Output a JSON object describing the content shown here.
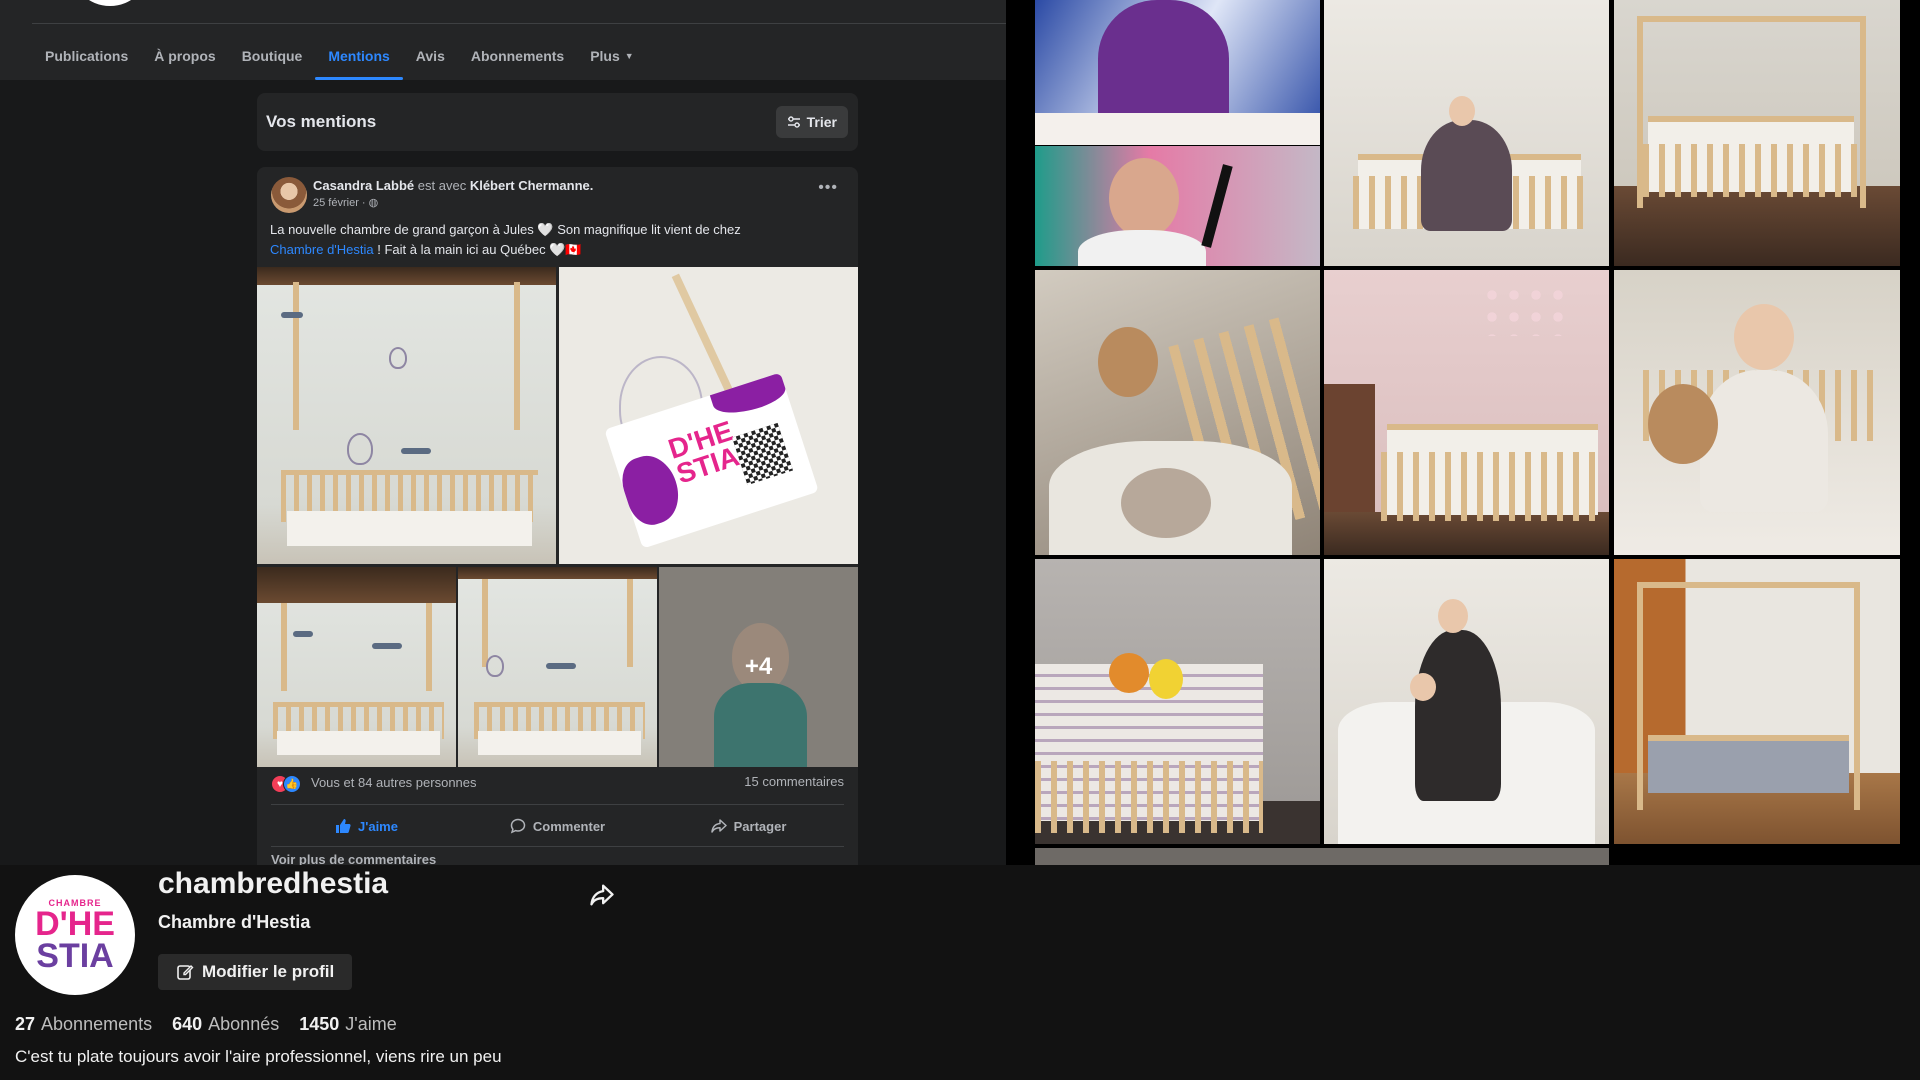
{
  "facebook": {
    "tabs": [
      {
        "label": "Publications"
      },
      {
        "label": "À propos"
      },
      {
        "label": "Boutique"
      },
      {
        "label": "Mentions"
      },
      {
        "label": "Avis"
      },
      {
        "label": "Abonnements"
      },
      {
        "label": "Plus"
      }
    ],
    "active_tab": "Mentions",
    "mentions_title": "Vos mentions",
    "sort_label": "Trier",
    "post": {
      "author": "Casandra Labbé",
      "with_text": "est avec",
      "tagged": "Klébert Chermanne.",
      "date": "25 février · ",
      "text_line1": "La nouvelle chambre de grand garçon à Jules 🤍 Son magnifique lit vient de chez",
      "link_text": "Chambre d'Hestia",
      "text_line2_rest": " ! Fait à la main ici au Québec 🤍🇨🇦",
      "photo_overflow": "+4",
      "reactions_text": "Vous et 84 autres personnes",
      "comments_count": "15 commentaires",
      "like_label": "J'aime",
      "comment_label": "Commenter",
      "share_label": "Partager",
      "more_comments": "Voir plus de commentaires"
    }
  },
  "profile": {
    "username": "chambredhestia",
    "display_name": "Chambre d'Hestia",
    "edit_button": "Modifier le profil",
    "logo": {
      "top": "CHAMBRE",
      "line1": "D'HE",
      "line2": "STIA"
    },
    "stats": [
      {
        "value": "27",
        "label": "Abonnements"
      },
      {
        "value": "640",
        "label": "Abonnés"
      },
      {
        "value": "1450",
        "label": "J'aime"
      }
    ],
    "bio": "C'est tu plate toujours avoir l'aire professionnel, viens rire un peu"
  },
  "colors": {
    "fb_accent": "#2d88ff",
    "brand_pink": "#e5258c",
    "brand_purple": "#8b1fa3"
  }
}
